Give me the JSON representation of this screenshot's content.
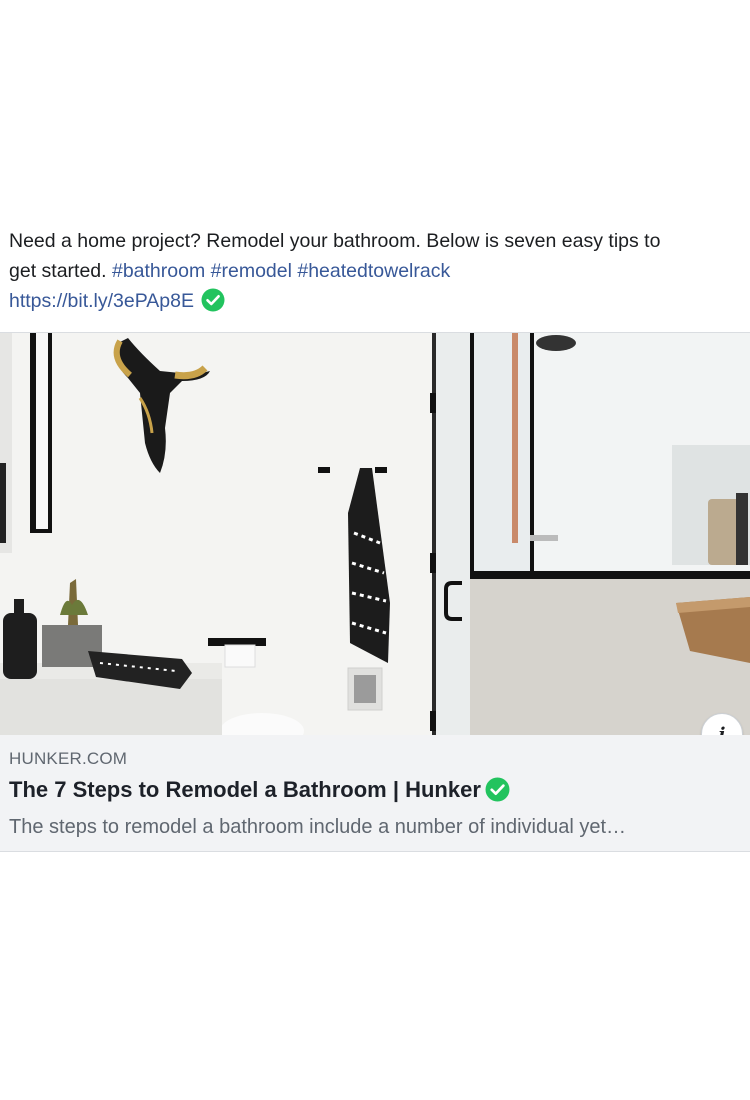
{
  "post": {
    "text_line1": "Need a home project? Remodel your bathroom. Below is seven easy tips to",
    "text_line2_prefix": "get started. ",
    "hashtags": [
      "#bathroom",
      "#remodel",
      "#heatedtowelrack"
    ],
    "link": "https://bit.ly/3ePAp8E",
    "link_icon": "check-circle-icon"
  },
  "card": {
    "image_alt": "Bathroom remodel photo",
    "domain": "HUNKER.COM",
    "title": "The 7 Steps to Remodel a Bathroom | Hunker",
    "title_icon": "check-circle-icon",
    "description": "The steps to remodel a bathroom include a number of individual yet…",
    "info_button_label": "i"
  },
  "colors": {
    "text": "#1c1e21",
    "link": "#385898",
    "meta_bg": "#f2f3f5",
    "muted": "#606770",
    "check_green": "#22c35e"
  }
}
